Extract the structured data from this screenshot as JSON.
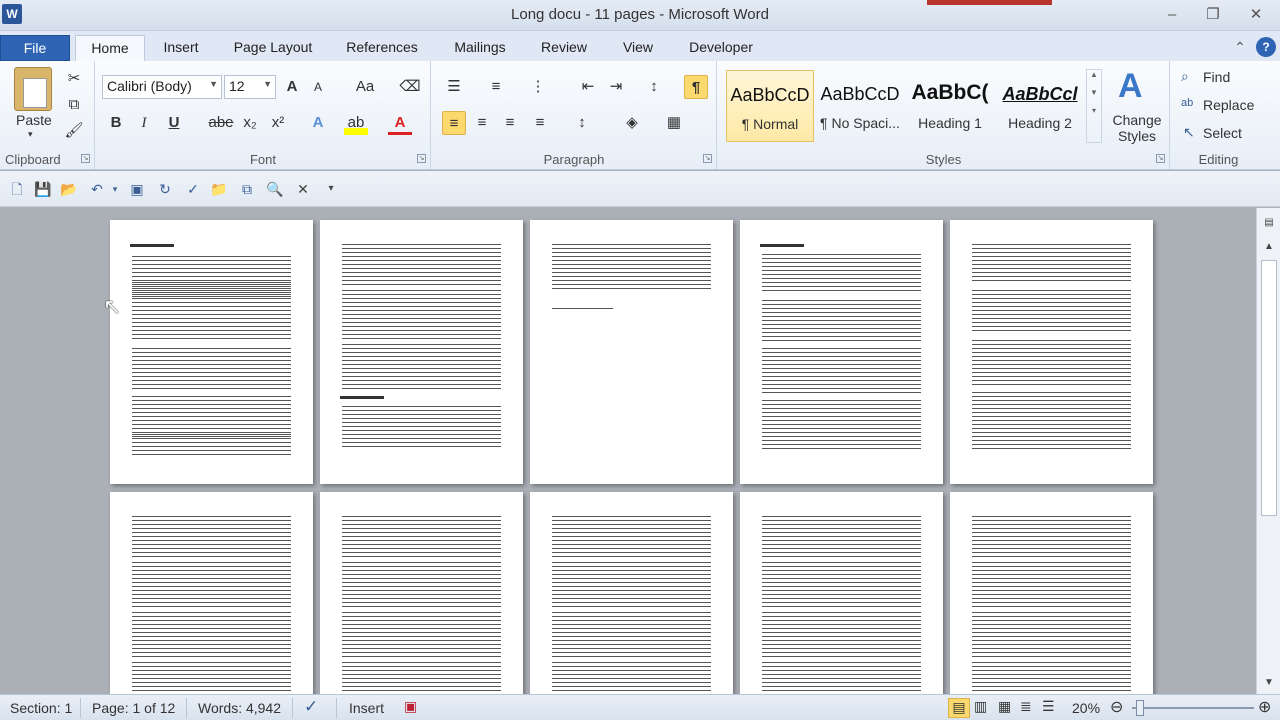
{
  "window": {
    "title": "Long docu - 11 pages - Microsoft Word",
    "minimize": "–",
    "restore": "❐",
    "close": "✕"
  },
  "tabs": [
    {
      "label": "File"
    },
    {
      "label": "Home"
    },
    {
      "label": "Insert"
    },
    {
      "label": "Page Layout"
    },
    {
      "label": "References"
    },
    {
      "label": "Mailings"
    },
    {
      "label": "Review"
    },
    {
      "label": "View"
    },
    {
      "label": "Developer"
    }
  ],
  "ribbon": {
    "clipboard": {
      "label": "Clipboard",
      "paste": "Paste"
    },
    "font": {
      "label": "Font",
      "face": "Calibri (Body)",
      "size": "12",
      "bold": "B",
      "italic": "I",
      "underline": "U",
      "strike": "abe",
      "sub": "x₂",
      "sup": "x²",
      "grow": "A",
      "shrink": "A",
      "case": "Aa",
      "color": "A"
    },
    "paragraph": {
      "label": "Paragraph",
      "pilcrow": "¶"
    },
    "styles": {
      "label": "Styles",
      "items": [
        {
          "sample": "AaBbCcD",
          "name": "¶ Normal"
        },
        {
          "sample": "AaBbCcD",
          "name": "¶ No Spaci..."
        },
        {
          "sample": "AaBbC(",
          "name": "Heading 1"
        },
        {
          "sample": "AaBbCcl",
          "name": "Heading 2"
        }
      ],
      "change": "Change Styles"
    },
    "editing": {
      "label": "Editing",
      "find": "Find",
      "replace": "Replace",
      "select": "Select"
    }
  },
  "status": {
    "section": "Section: 1",
    "page": "Page: 1 of 12",
    "words": "Words: 4,942",
    "mode": "Insert",
    "zoom": "20%"
  },
  "colors": {
    "file_tab": "#2f64b4",
    "selection": "#fbd96d",
    "workspace": "#abafb6"
  }
}
